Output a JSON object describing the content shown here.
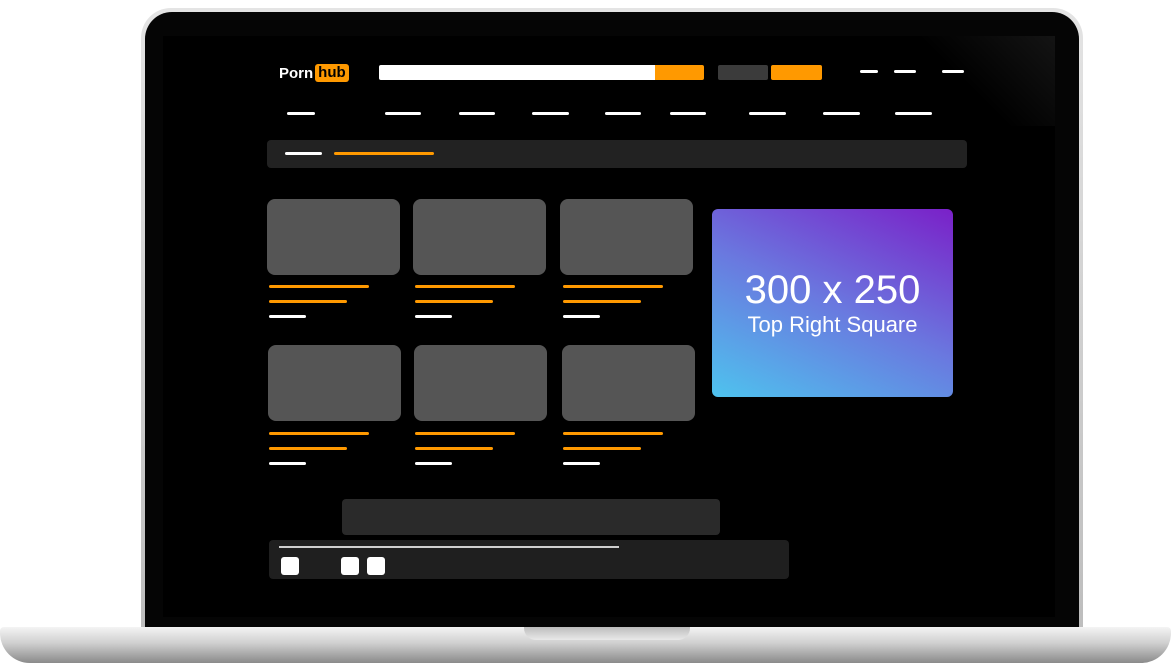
{
  "logo": {
    "part1": "Porn",
    "part2": "hub"
  },
  "ad": {
    "size": "300 x 250",
    "name": "Top Right Square"
  },
  "colors": {
    "accent": "#ff9900",
    "screen_bg": "#000000",
    "placeholder": "#555555"
  },
  "nav_items_count": 9,
  "video_grid": {
    "rows": 2,
    "columns": 3
  }
}
